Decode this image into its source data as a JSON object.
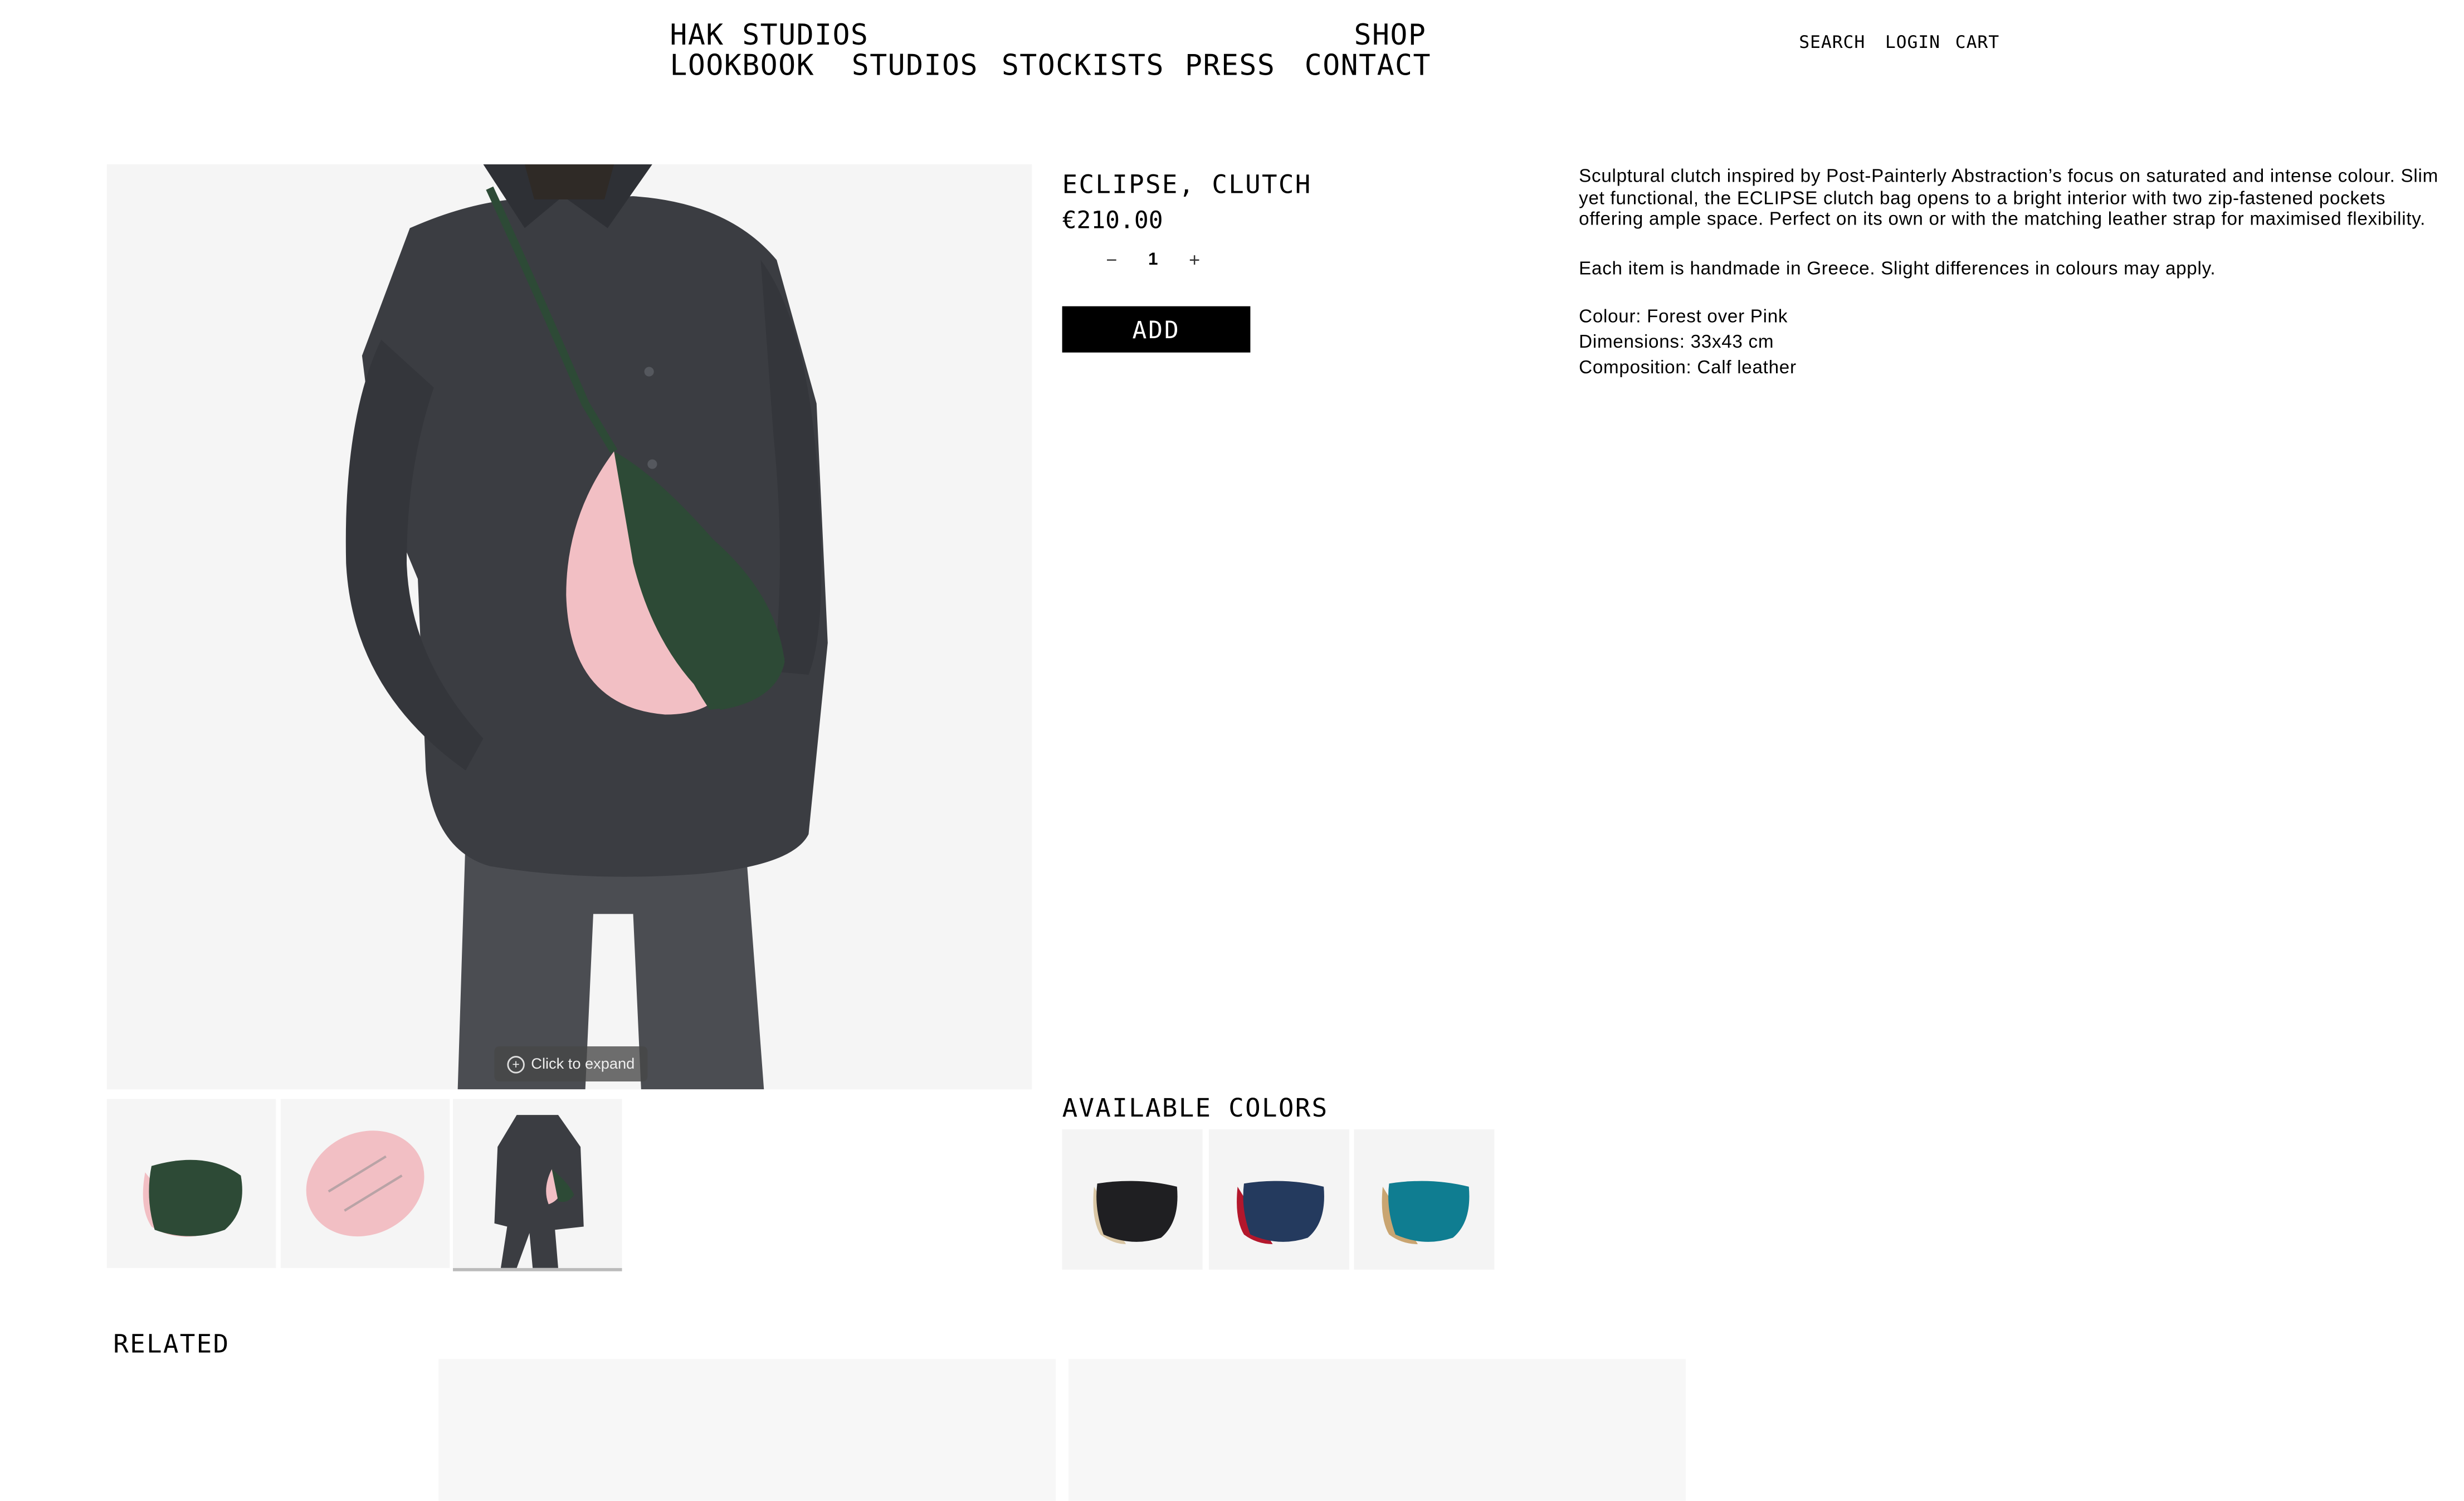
{
  "nav": {
    "brand": "HAK STUDIOS",
    "shop": "SHOP",
    "links": [
      "LOOKBOOK",
      "STUDIOS",
      "STOCKISTS",
      "PRESS",
      "CONTACT"
    ]
  },
  "utility": {
    "search": "SEARCH",
    "login": "LOGIN",
    "cart": "CART"
  },
  "product": {
    "title": "ECLIPSE, CLUTCH",
    "price": "€210.00",
    "quantity": "1",
    "qty_minus": "−",
    "qty_plus": "+",
    "add_label": "ADD",
    "expand_label": "Click to expand",
    "description": [
      "Sculptural clutch inspired by Post-Painterly Abstraction’s focus on saturated and intense colour. Slim yet functional, the ECLIPSE clutch bag opens to a bright interior with two zip-fastened pockets offering ample space. Perfect on its own or with the matching leather strap for maximised flexibility.",
      "Each item is handmade in Greece. Slight differences in colours may apply."
    ],
    "specs": [
      "Colour: Forest over Pink",
      "Dimensions: 33x43 cm",
      "Composition: Calf leather"
    ]
  },
  "colors": {
    "heading": "AVAILABLE COLORS",
    "swatches": [
      {
        "name": "black-over-beige",
        "outer": "#1f1f22",
        "inner": "#d8c5a3"
      },
      {
        "name": "navy-over-red",
        "outer": "#243a5e",
        "inner": "#b3172c"
      },
      {
        "name": "teal-over-tan",
        "outer": "#0f7d91",
        "inner": "#c9a571"
      }
    ]
  },
  "related": {
    "heading": "RELATED"
  },
  "palette": {
    "forest": "#2d4a36",
    "pink": "#f2bfc4",
    "shirt": "#3b3d42",
    "bg": "#f5f5f5"
  }
}
